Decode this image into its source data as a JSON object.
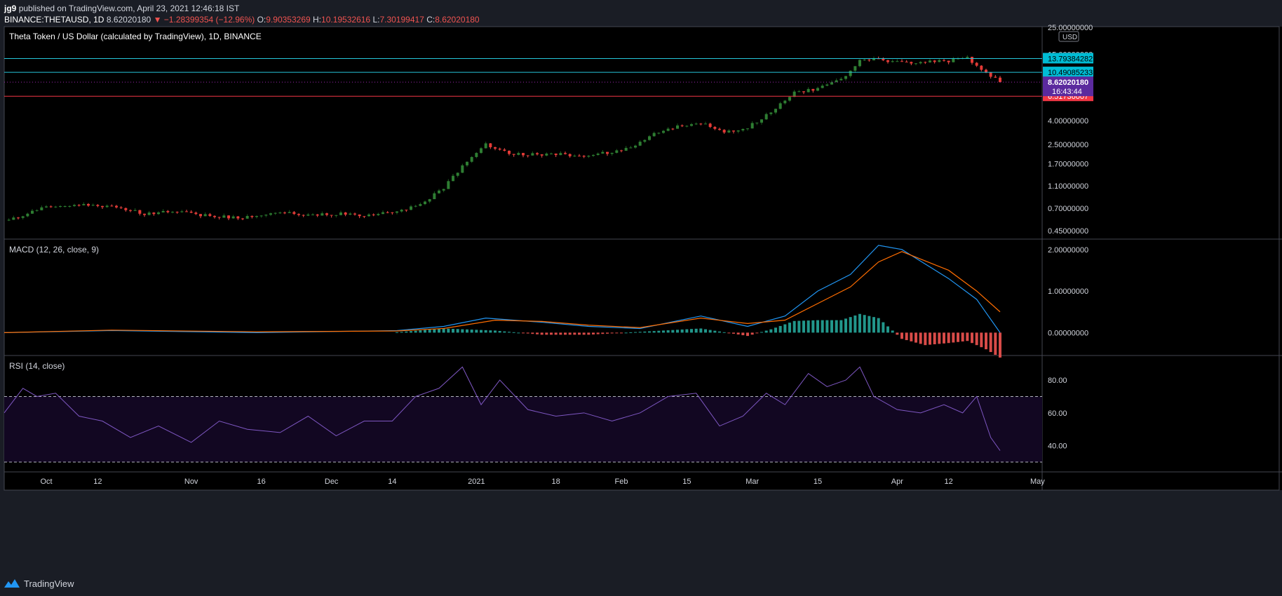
{
  "header": {
    "author": "jg9",
    "published_text": "published on TradingView.com, April 23, 2021 12:46:18 IST",
    "symbol": "BINANCE:THETAUSD, 1D",
    "last": "8.62020180",
    "change": "−1.28399354 (−12.96%)",
    "o_label": "O:",
    "o": "9.90353269",
    "h_label": "H:",
    "h": "10.19532616",
    "l_label": "L:",
    "l": "7.30199417",
    "c_label": "C:",
    "c": "8.62020180"
  },
  "footer": {
    "brand": "TradingView",
    "logo_icon": "tradingview-logo-icon"
  },
  "colors": {
    "background": "#000000",
    "frame": "#1a1d25",
    "up": "#26a69a",
    "up_candle": "#1b5e20",
    "down": "#ef5350",
    "hline_cyan": "#26c6da",
    "hline_red": "#f23645",
    "macd": "#2196f3",
    "signal": "#ff6d00",
    "rsi": "#7e57c2",
    "rsi_band": "#120722",
    "last_price_badge": "#5b2a9e"
  },
  "chart_data": [
    {
      "type": "candlestick",
      "title": "Theta Token / US Dollar (calculated by TradingView), 1D, BINANCE",
      "currency": "USD",
      "scale": "log",
      "y_ticks": [
        "25.00000000",
        "15.00000000",
        "4.00000000",
        "2.50000000",
        "1.70000000",
        "1.10000000",
        "0.70000000",
        "0.45000000"
      ],
      "y_tick_values": [
        25,
        15,
        4,
        2.5,
        1.7,
        1.1,
        0.7,
        0.45
      ],
      "ylim": [
        0.38,
        26
      ],
      "x_ticks": [
        "Oct",
        "12",
        "Nov",
        "16",
        "Dec",
        "14",
        "2021",
        "18",
        "Feb",
        "15",
        "Mar",
        "15",
        "Apr",
        "12",
        "May"
      ],
      "x_tick_dates": [
        "2020-10-01",
        "2020-10-12",
        "2020-11-01",
        "2020-11-16",
        "2020-12-01",
        "2020-12-14",
        "2021-01-01",
        "2021-01-18",
        "2021-02-01",
        "2021-02-15",
        "2021-03-01",
        "2021-03-15",
        "2021-04-01",
        "2021-04-12",
        "2021-05-01"
      ],
      "x_range": [
        "2020-09-22",
        "2021-05-02"
      ],
      "close_dates": [
        "2020-09-23",
        "2020-10-01",
        "2020-10-08",
        "2020-10-15",
        "2020-10-22",
        "2020-10-29",
        "2020-11-05",
        "2020-11-12",
        "2020-11-19",
        "2020-11-26",
        "2020-12-03",
        "2020-12-10",
        "2020-12-15",
        "2020-12-20",
        "2020-12-25",
        "2020-12-30",
        "2021-01-03",
        "2021-01-08",
        "2021-01-13",
        "2021-01-18",
        "2021-01-23",
        "2021-01-28",
        "2021-02-03",
        "2021-02-08",
        "2021-02-13",
        "2021-02-18",
        "2021-02-23",
        "2021-02-28",
        "2021-03-05",
        "2021-03-10",
        "2021-03-15",
        "2021-03-20",
        "2021-03-24",
        "2021-03-28",
        "2021-04-02",
        "2021-04-07",
        "2021-04-12",
        "2021-04-16",
        "2021-04-19",
        "2021-04-23"
      ],
      "close_values": [
        0.55,
        0.72,
        0.75,
        0.73,
        0.63,
        0.66,
        0.6,
        0.58,
        0.65,
        0.61,
        0.63,
        0.61,
        0.67,
        0.75,
        1.05,
        1.8,
        2.5,
        2.1,
        2.05,
        2.08,
        1.95,
        2.1,
        2.3,
        3.1,
        3.55,
        3.8,
        3.2,
        3.5,
        4.8,
        7.0,
        7.6,
        9.0,
        13.5,
        13.4,
        12.6,
        13.0,
        13.2,
        14.0,
        11.2,
        8.62
      ],
      "horizontal_lines": [
        {
          "label": "13.79384282",
          "value": 13.79384282,
          "color": "cyan"
        },
        {
          "label": "10.49085233",
          "value": 10.49085233,
          "color": "cyan"
        },
        {
          "label": "6.51736007",
          "value": 6.51736007,
          "color": "red"
        }
      ],
      "last_price": {
        "label": "8.62020180",
        "value": 8.6202018,
        "countdown": "16:43:44"
      }
    },
    {
      "type": "line",
      "title": "MACD (12, 26, close, 9)",
      "y_ticks": [
        "2.00000000",
        "1.00000000",
        "0.00000000"
      ],
      "y_tick_values": [
        2,
        1,
        0
      ],
      "ylim": [
        -0.55,
        2.25
      ],
      "series": [
        {
          "name": "MACD",
          "dates": [
            "2020-09-22",
            "2020-10-15",
            "2020-11-15",
            "2020-12-15",
            "2020-12-25",
            "2021-01-03",
            "2021-01-15",
            "2021-01-25",
            "2021-02-05",
            "2021-02-18",
            "2021-02-28",
            "2021-03-08",
            "2021-03-15",
            "2021-03-22",
            "2021-03-28",
            "2021-04-02",
            "2021-04-12",
            "2021-04-18",
            "2021-04-23"
          ],
          "values": [
            0.0,
            0.05,
            0.0,
            0.05,
            0.15,
            0.35,
            0.25,
            0.15,
            0.1,
            0.4,
            0.15,
            0.4,
            1.0,
            1.4,
            2.1,
            2.0,
            1.3,
            0.8,
            0.0
          ]
        },
        {
          "name": "Signal",
          "dates": [
            "2020-09-22",
            "2020-10-15",
            "2020-11-15",
            "2020-12-15",
            "2020-12-25",
            "2021-01-05",
            "2021-01-15",
            "2021-01-25",
            "2021-02-05",
            "2021-02-18",
            "2021-02-28",
            "2021-03-08",
            "2021-03-15",
            "2021-03-22",
            "2021-03-28",
            "2021-04-02",
            "2021-04-12",
            "2021-04-18",
            "2021-04-23"
          ],
          "values": [
            0.0,
            0.06,
            0.02,
            0.04,
            0.1,
            0.3,
            0.27,
            0.18,
            0.12,
            0.35,
            0.22,
            0.3,
            0.7,
            1.1,
            1.7,
            1.95,
            1.5,
            1.0,
            0.5
          ]
        }
      ],
      "histogram": {
        "name": "Histogram",
        "dates": [
          "2020-12-15",
          "2020-12-25",
          "2021-01-05",
          "2021-01-15",
          "2021-01-25",
          "2021-02-05",
          "2021-02-18",
          "2021-02-28",
          "2021-03-05",
          "2021-03-10",
          "2021-03-15",
          "2021-03-20",
          "2021-03-24",
          "2021-03-28",
          "2021-04-02",
          "2021-04-07",
          "2021-04-12",
          "2021-04-16",
          "2021-04-20",
          "2021-04-23"
        ],
        "values": [
          0.01,
          0.1,
          0.05,
          -0.05,
          -0.05,
          0.02,
          0.1,
          -0.08,
          0.08,
          0.28,
          0.3,
          0.3,
          0.45,
          0.35,
          -0.15,
          -0.3,
          -0.25,
          -0.2,
          -0.4,
          -0.6
        ]
      }
    },
    {
      "type": "line",
      "title": "RSI (14, close)",
      "y_ticks": [
        "80.00",
        "60.00",
        "40.00"
      ],
      "y_tick_values": [
        80,
        60,
        40
      ],
      "ylim": [
        24,
        95
      ],
      "bands": [
        70,
        30
      ],
      "series": [
        {
          "name": "RSI",
          "dates": [
            "2020-09-22",
            "2020-09-26",
            "2020-09-29",
            "2020-10-03",
            "2020-10-08",
            "2020-10-13",
            "2020-10-19",
            "2020-10-25",
            "2020-11-01",
            "2020-11-07",
            "2020-11-13",
            "2020-11-20",
            "2020-11-26",
            "2020-12-02",
            "2020-12-08",
            "2020-12-14",
            "2020-12-19",
            "2020-12-24",
            "2020-12-29",
            "2021-01-02",
            "2021-01-06",
            "2021-01-12",
            "2021-01-18",
            "2021-01-24",
            "2021-01-30",
            "2021-02-05",
            "2021-02-11",
            "2021-02-17",
            "2021-02-22",
            "2021-02-27",
            "2021-03-04",
            "2021-03-08",
            "2021-03-13",
            "2021-03-17",
            "2021-03-21",
            "2021-03-24",
            "2021-03-27",
            "2021-04-01",
            "2021-04-06",
            "2021-04-11",
            "2021-04-15",
            "2021-04-18",
            "2021-04-21",
            "2021-04-23"
          ],
          "values": [
            60,
            75,
            70,
            72,
            58,
            55,
            45,
            52,
            42,
            55,
            50,
            48,
            58,
            46,
            55,
            55,
            70,
            75,
            88,
            65,
            80,
            62,
            58,
            60,
            55,
            60,
            70,
            72,
            52,
            58,
            72,
            65,
            84,
            76,
            80,
            88,
            70,
            62,
            60,
            65,
            60,
            70,
            45,
            37
          ]
        }
      ]
    }
  ]
}
